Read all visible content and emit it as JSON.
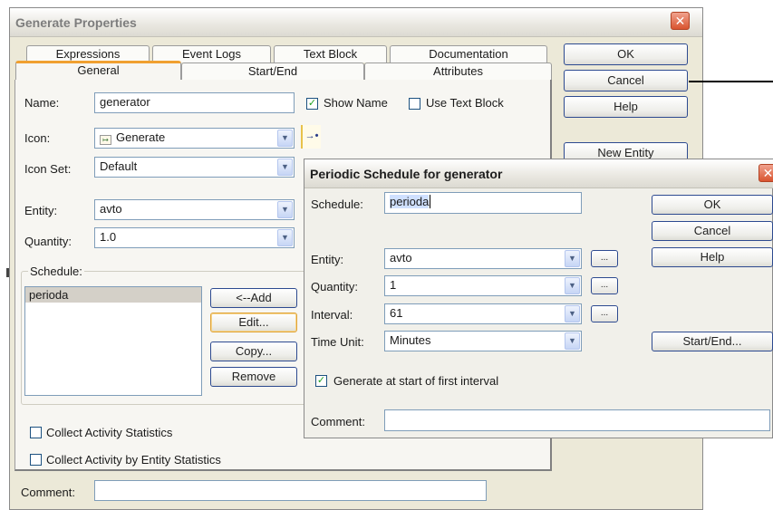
{
  "main_dialog": {
    "title": "Generate Properties",
    "close_glyph": "✕",
    "tabs_back": [
      "Expressions",
      "Event Logs",
      "Text Block",
      "Documentation"
    ],
    "tabs_front": [
      "General",
      "Start/End",
      "Attributes"
    ],
    "buttons": {
      "ok": "OK",
      "cancel": "Cancel",
      "help": "Help",
      "new_entity": "New Entity"
    },
    "fields": {
      "name_label": "Name:",
      "name_value": "generator",
      "show_name_label": "Show Name",
      "show_name_checked": true,
      "use_text_block_label": "Use Text Block",
      "use_text_block_checked": false,
      "icon_label": "Icon:",
      "icon_value": "Generate",
      "icon_set_label": "Icon Set:",
      "icon_set_value": "Default",
      "entity_label": "Entity:",
      "entity_value": "avto",
      "quantity_label": "Quantity:",
      "quantity_value": "1.0"
    },
    "schedule": {
      "group_label": "Schedule:",
      "items": [
        "perioda"
      ],
      "add": "<--Add",
      "edit": "Edit...",
      "copy": "Copy...",
      "remove": "Remove"
    },
    "collect_activity_statistics": "Collect Activity Statistics",
    "collect_by_entity_statistics": "Collect Activity by Entity Statistics",
    "comment_label": "Comment:",
    "comment_value": ""
  },
  "periodic_dialog": {
    "title": "Periodic Schedule for generator",
    "close_glyph": "✕",
    "schedule_label": "Schedule:",
    "schedule_value": "perioda",
    "entity_label": "Entity:",
    "entity_value": "avto",
    "quantity_label": "Quantity:",
    "quantity_value": "1",
    "interval_label": "Interval:",
    "interval_value": "61",
    "time_unit_label": "Time Unit:",
    "time_unit_value": "Minutes",
    "generate_at_start_label": "Generate at start of first interval",
    "generate_at_start_checked": true,
    "comment_label": "Comment:",
    "comment_value": "",
    "ellipsis": "...",
    "buttons": {
      "ok": "OK",
      "cancel": "Cancel",
      "help": "Help",
      "start_end": "Start/End..."
    }
  },
  "icons": {
    "generate_icon": "generate-arrow-icon",
    "dropdown": "chevron-down-icon",
    "close": "close-icon",
    "check": "checkmark-icon"
  },
  "colors": {
    "dialog_bg": "#ece9d8",
    "active_tab_accent": "#f0a030",
    "button_border": "#2d4a90",
    "focus_border": "#e0a43a",
    "close_button": "#d9542f",
    "checkmark": "#21a121"
  }
}
